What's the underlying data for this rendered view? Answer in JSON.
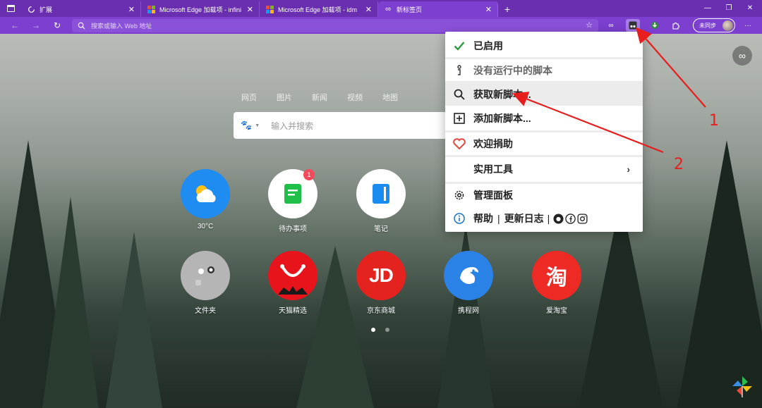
{
  "tabs": [
    {
      "label": "扩展",
      "icon": "extensions-icon"
    },
    {
      "label": "Microsoft Edge 加载项 - infinity新",
      "icon": "microsoft-logo-icon"
    },
    {
      "label": "Microsoft Edge 加载项 - idm",
      "icon": "microsoft-logo-icon"
    },
    {
      "label": "新标签页",
      "icon": "infinity-icon",
      "active": true
    }
  ],
  "omnibox": {
    "placeholder": "搜索或输入 Web 地址"
  },
  "sync": {
    "label": "未同步"
  },
  "search": {
    "tabs": [
      "网页",
      "图片",
      "新闻",
      "视频",
      "地图"
    ],
    "placeholder": "输入并搜索"
  },
  "apps": [
    {
      "label": "30°C",
      "icon": "weather-icon",
      "color": "#1f8cf2"
    },
    {
      "label": "待办事项",
      "icon": "todo-icon",
      "color": "#ffffff",
      "badge": "1"
    },
    {
      "label": "笔记",
      "icon": "notes-icon",
      "color": "#ffffff"
    },
    {
      "label": "文件夹",
      "icon": "folder-icon",
      "color": "#b5b5b5"
    },
    {
      "label": "天猫精选",
      "icon": "tmall-icon",
      "color": "#e8141c"
    },
    {
      "label": "京东商城",
      "icon": "jd-icon",
      "color": "#e4231f",
      "glyph": "JD"
    },
    {
      "label": "携程网",
      "icon": "ctrip-icon",
      "color": "#2b82e6"
    },
    {
      "label": "爱淘宝",
      "icon": "taobao-icon",
      "color": "#ee2a24",
      "glyph": "淘"
    }
  ],
  "menu": {
    "enabled": "已启用",
    "no_scripts": "没有运行中的脚本",
    "get_scripts": "获取新脚本...",
    "add_script": "添加新脚本...",
    "donate": "欢迎捐助",
    "utilities": "实用工具",
    "dashboard": "管理面板",
    "help": "帮助",
    "changelog": "更新日志"
  },
  "annotations": [
    "1",
    "2"
  ],
  "colors": {
    "tab_bar": "#6a2fb0",
    "toolbar": "#7c3fd0",
    "arrow": "#e81e1e",
    "check": "#2e9b3f",
    "heart": "#e04a3f"
  }
}
